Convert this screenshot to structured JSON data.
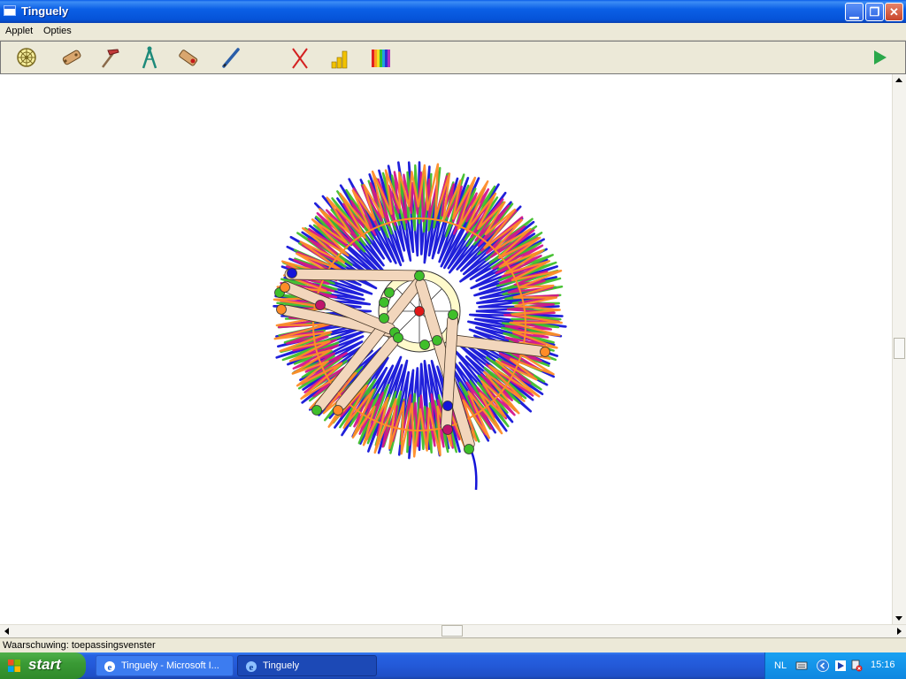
{
  "window": {
    "title": "Tinguely",
    "minimize_glyph": "▁",
    "maximize_glyph": "❐",
    "close_glyph": "✕"
  },
  "menu": {
    "items": [
      "Applet",
      "Opties"
    ]
  },
  "toolbar": {
    "tools": [
      {
        "icon": "wheel-icon"
      },
      {
        "icon": "bar-piece-icon"
      },
      {
        "icon": "hammer-icon"
      },
      {
        "icon": "compass-legs-icon"
      },
      {
        "icon": "pen-holder-icon"
      },
      {
        "icon": "pencil-icon"
      },
      {
        "icon": "delete-x-icon"
      },
      {
        "icon": "bar-chart-icon"
      },
      {
        "icon": "color-palette-icon"
      },
      {
        "icon": "play-icon"
      }
    ]
  },
  "status": {
    "text": "Waarschuwing: toepassingsvenster"
  },
  "taskbar": {
    "start_label": "start",
    "buttons": [
      {
        "label": "Tinguely - Microsoft I...",
        "icon": "internet-explorer-icon"
      },
      {
        "label": "Tinguely",
        "icon": "internet-explorer-icon"
      }
    ],
    "tray": {
      "language": "NL",
      "time": "15:16"
    }
  },
  "colors": {
    "pen_blue": "#1414d8",
    "pen_green": "#3fbf2a",
    "pen_magenta": "#d4148c",
    "pen_orange": "#ff8c28",
    "bar_fill": "#f2d6bc",
    "wheel_fill": "#fffacb"
  }
}
